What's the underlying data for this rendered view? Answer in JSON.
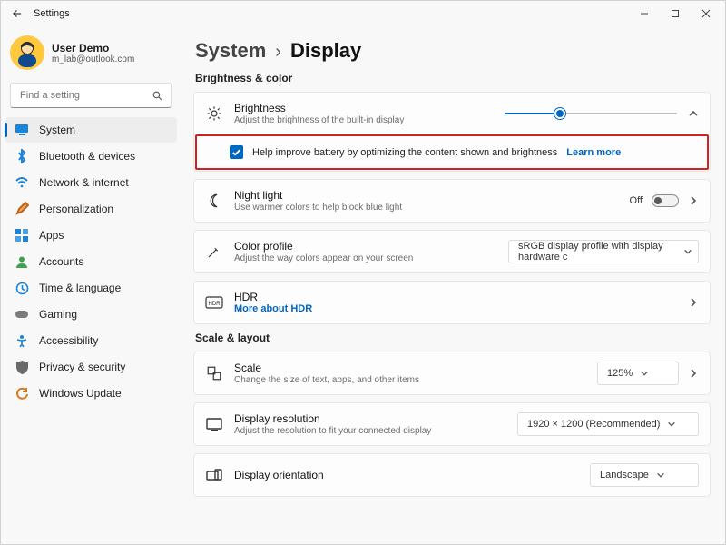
{
  "titlebar": {
    "title": "Settings"
  },
  "user": {
    "name": "User Demo",
    "email": "m_lab@outlook.com"
  },
  "search": {
    "placeholder": "Find a setting"
  },
  "nav": {
    "items": [
      {
        "label": "System"
      },
      {
        "label": "Bluetooth & devices"
      },
      {
        "label": "Network & internet"
      },
      {
        "label": "Personalization"
      },
      {
        "label": "Apps"
      },
      {
        "label": "Accounts"
      },
      {
        "label": "Time & language"
      },
      {
        "label": "Gaming"
      },
      {
        "label": "Accessibility"
      },
      {
        "label": "Privacy & security"
      },
      {
        "label": "Windows Update"
      }
    ]
  },
  "breadcrumb": {
    "parent": "System",
    "current": "Display"
  },
  "sections": {
    "brightness_color": "Brightness & color",
    "scale_layout": "Scale & layout"
  },
  "brightness": {
    "title": "Brightness",
    "sub": "Adjust the brightness of the built-in display",
    "battery_checkbox": "Help improve battery by optimizing the content shown and brightness",
    "learn_more": "Learn more"
  },
  "night_light": {
    "title": "Night light",
    "sub": "Use warmer colors to help block blue light",
    "state": "Off"
  },
  "color_profile": {
    "title": "Color profile",
    "sub": "Adjust the way colors appear on your screen",
    "value": "sRGB display profile with display hardware c"
  },
  "hdr": {
    "title": "HDR",
    "link": "More about HDR"
  },
  "scale": {
    "title": "Scale",
    "sub": "Change the size of text, apps, and other items",
    "value": "125%"
  },
  "resolution": {
    "title": "Display resolution",
    "sub": "Adjust the resolution to fit your connected display",
    "value": "1920 × 1200 (Recommended)"
  },
  "orientation": {
    "title": "Display orientation",
    "value": "Landscape"
  }
}
